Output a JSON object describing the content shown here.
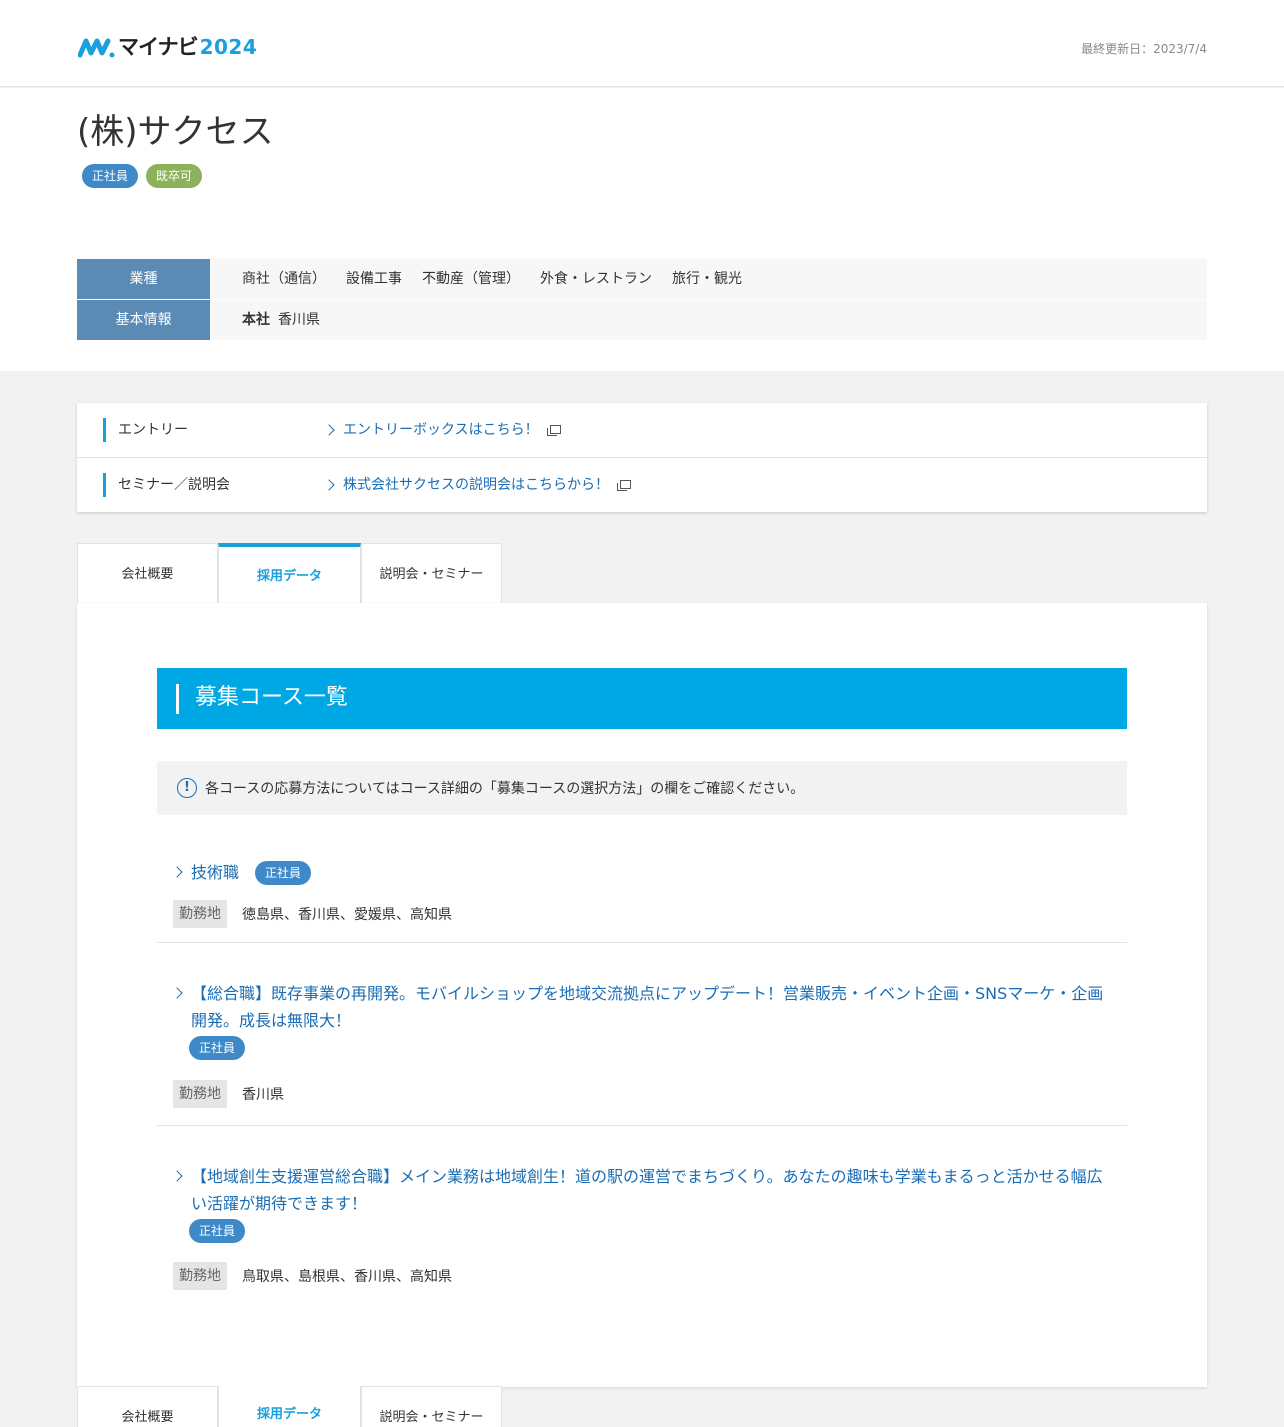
{
  "header": {
    "logo_text": "マイナビ",
    "logo_year": "2024",
    "updated": "最終更新日：2023/7/4"
  },
  "company": {
    "name": "(株)サクセス",
    "tags": [
      "正社員",
      "既卒可"
    ],
    "industry_label": "業種",
    "industries": [
      "商社（通信）",
      "設備工事",
      "不動産（管理）",
      "外食・レストラン",
      "旅行・観光"
    ],
    "basic_label": "基本情報",
    "hq_label": "本社",
    "hq_value": "香川県"
  },
  "entry": {
    "rows": [
      {
        "label": "エントリー",
        "link": "エントリーボックスはこちら！"
      },
      {
        "label": "セミナー／説明会",
        "link": "株式会社サクセスの説明会はこちらから！"
      }
    ]
  },
  "tabs": [
    "会社概要",
    "採用データ",
    "説明会・セミナー"
  ],
  "active_tab": "採用データ",
  "section": {
    "title": "募集コース一覧",
    "notice": "各コースの応募方法についてはコース詳細の「募集コースの選択方法」の欄をご確認ください。"
  },
  "courses": [
    {
      "title": "技術職",
      "tag": "正社員",
      "loc_label": "勤務地",
      "loc": "徳島県、香川県、愛媛県、高知県"
    },
    {
      "title_line1": "【総合職】既存事業の再開発。モバイルショップを地域交流拠点にアップデート！営業販売・イベント企画・SNSマーケ・企画",
      "title_line2": "開発。成長は無限大！",
      "tag": "正社員",
      "loc_label": "勤務地",
      "loc": "香川県"
    },
    {
      "title_line1": "【地域創生支援運営総合職】メイン業務は地域創生！道の駅の運営でまちづくり。あなたの趣味も学業もまるっと活かせる幅広",
      "title_line2": "い活躍が期待できます！",
      "tag": "正社員",
      "loc_label": "勤務地",
      "loc": "鳥取県、島根県、香川県、高知県"
    }
  ],
  "colors": {
    "accent": "#00a7e5",
    "link": "#1a6db5",
    "th": "#5b8bb4",
    "tag_blue": "#3e8ac8",
    "tag_green": "#8bb25a"
  }
}
